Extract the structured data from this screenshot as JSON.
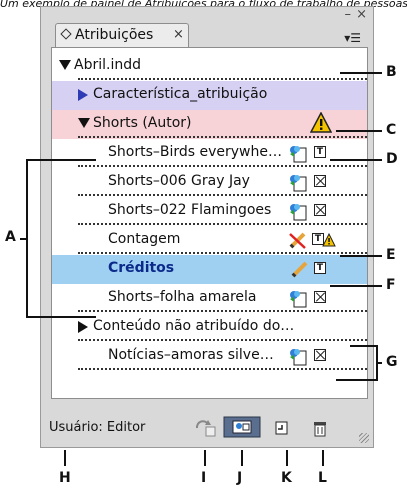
{
  "caption": "Um exemplo de painel de Atribuições para o fluxo de trabalho de pessoas",
  "panel": {
    "window_controls": {
      "minimize": "–",
      "close": "×"
    },
    "tab": {
      "label": "Atribuições",
      "close_glyph": "×"
    },
    "menu_glyph": "▾☰",
    "rows": [
      {
        "label": "Abril.indd"
      },
      {
        "label": "Característica_atribuição"
      },
      {
        "label": "Shorts (Autor)"
      },
      {
        "label": "Shorts–Birds everywhe…"
      },
      {
        "label": "Shorts–006 Gray Jay"
      },
      {
        "label": "Shorts–022 Flamingoes"
      },
      {
        "label": "Contagem"
      },
      {
        "label": "Créditos"
      },
      {
        "label": "Shorts–folha amarela"
      },
      {
        "label": "Conteúdo não atribuído do…"
      },
      {
        "label": "Notícias–amoras silve…"
      }
    ],
    "footer": {
      "user_label": "Usuário: Editor"
    }
  },
  "callouts": [
    "A",
    "B",
    "C",
    "D",
    "E",
    "F",
    "G",
    "H",
    "I",
    "J",
    "K",
    "L"
  ],
  "colors": {
    "assignment_row": "#d6d0f2",
    "assignment_header_row": "#f7d2d6",
    "selected_row": "#9fd0f2",
    "selected_text": "#0b2a8a",
    "panel_bg": "#d9d9d9"
  },
  "icons": {
    "group_arrow": "triangle-icon",
    "warning": "warning-triangle-icon",
    "linked_story": "linked-story-icon",
    "text_frame": "text-frame-icon",
    "placeholder": "placeholder-frame-icon",
    "edit_pencil": "pencil-icon",
    "no_edit": "crossed-pencil-icon",
    "update": "update-content-icon",
    "assign": "assign-icon",
    "new": "new-assignment-icon",
    "delete": "trash-icon"
  }
}
